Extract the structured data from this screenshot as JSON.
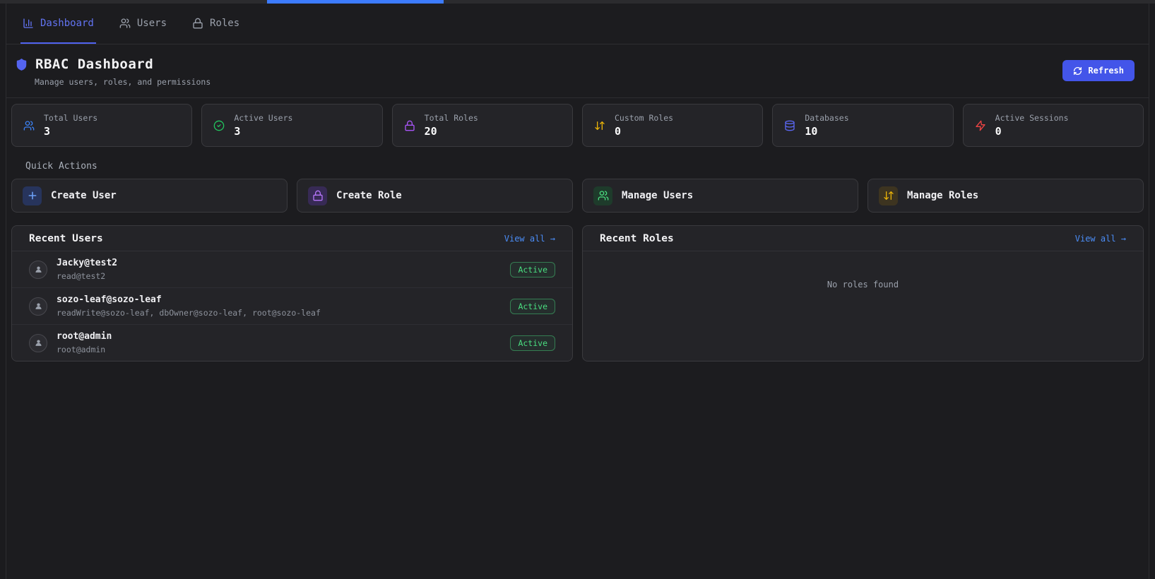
{
  "browser": {
    "active_tab_indicator_color": "#3c7bfd"
  },
  "nav": {
    "tabs": [
      {
        "label": "Dashboard",
        "icon": "bar-chart-icon",
        "active": true
      },
      {
        "label": "Users",
        "icon": "users-icon",
        "active": false
      },
      {
        "label": "Roles",
        "icon": "lock-icon",
        "active": false
      }
    ]
  },
  "header": {
    "title": "RBAC Dashboard",
    "subtitle": "Manage users, roles, and permissions",
    "refresh_label": "Refresh",
    "accent_color": "#4355e9"
  },
  "stats": [
    {
      "label": "Total Users",
      "value": "3",
      "icon": "users-icon",
      "color": "#3b82f6"
    },
    {
      "label": "Active Users",
      "value": "3",
      "icon": "check-circle-icon",
      "color": "#22c55e"
    },
    {
      "label": "Total Roles",
      "value": "20",
      "icon": "lock-icon",
      "color": "#a855f7"
    },
    {
      "label": "Custom Roles",
      "value": "0",
      "icon": "arrows-up-down-icon",
      "color": "#eab308"
    },
    {
      "label": "Databases",
      "value": "10",
      "icon": "database-icon",
      "color": "#5b67f2"
    },
    {
      "label": "Active Sessions",
      "value": "0",
      "icon": "zap-icon",
      "color": "#ef4444"
    }
  ],
  "quick_actions": {
    "heading": "Quick Actions",
    "actions": [
      {
        "label": "Create User",
        "icon": "plus-icon",
        "color": "#6ca0f6",
        "bg": "#27345c"
      },
      {
        "label": "Create Role",
        "icon": "lock-icon",
        "color": "#b575f8",
        "bg": "#372a55"
      },
      {
        "label": "Manage Users",
        "icon": "users-icon",
        "color": "#4ade80",
        "bg": "#1e3b2b"
      },
      {
        "label": "Manage Roles",
        "icon": "arrows-up-down-icon",
        "color": "#eab308",
        "bg": "#3d3420"
      }
    ]
  },
  "recent_users": {
    "title": "Recent Users",
    "view_all_label": "View all →",
    "rows": [
      {
        "name": "Jacky@test2",
        "roles": "read@test2",
        "status": "Active"
      },
      {
        "name": "sozo-leaf@sozo-leaf",
        "roles": "readWrite@sozo-leaf, dbOwner@sozo-leaf, root@sozo-leaf",
        "status": "Active"
      },
      {
        "name": "root@admin",
        "roles": "root@admin",
        "status": "Active"
      }
    ]
  },
  "recent_roles": {
    "title": "Recent Roles",
    "view_all_label": "View all →",
    "empty_message": "No roles found"
  }
}
